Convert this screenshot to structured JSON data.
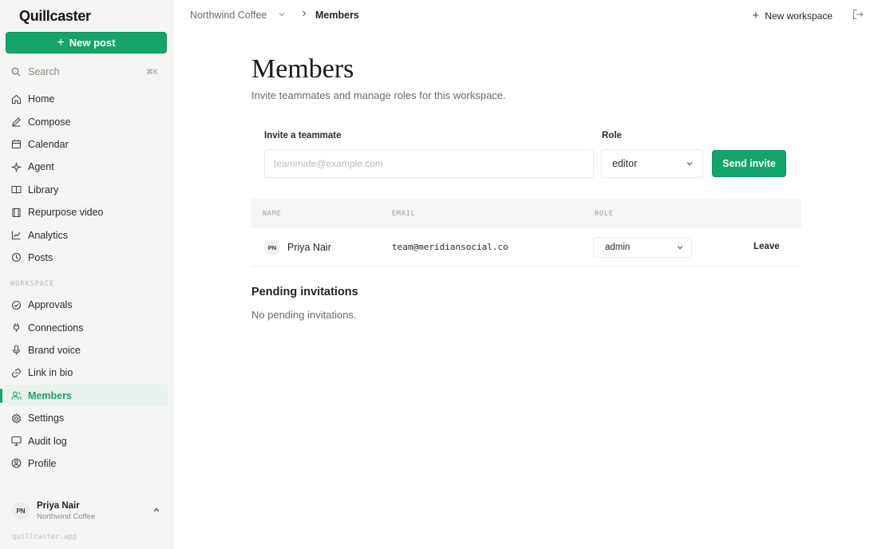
{
  "app": {
    "brand": "Quillcaster",
    "domain_footer": "quillcaster.app"
  },
  "sidebar": {
    "new_post_label": "New post",
    "search": {
      "placeholder": "Search",
      "shortcut": "⌘K"
    },
    "items": [
      {
        "label": "Home",
        "icon": "home-icon"
      },
      {
        "label": "Compose",
        "icon": "pencil-icon"
      },
      {
        "label": "Calendar",
        "icon": "calendar-icon"
      },
      {
        "label": "Agent",
        "icon": "sparkle-icon"
      },
      {
        "label": "Library",
        "icon": "book-icon"
      },
      {
        "label": "Repurpose video",
        "icon": "film-icon"
      },
      {
        "label": "Analytics",
        "icon": "chart-icon"
      },
      {
        "label": "Posts",
        "icon": "clock-icon"
      }
    ],
    "section_label": "WORKSPACE",
    "workspace_items": [
      {
        "label": "Approvals",
        "icon": "check-circle-icon"
      },
      {
        "label": "Connections",
        "icon": "plug-icon"
      },
      {
        "label": "Brand voice",
        "icon": "mic-icon"
      },
      {
        "label": "Link in bio",
        "icon": "link-icon"
      },
      {
        "label": "Members",
        "icon": "users-icon",
        "active": true
      },
      {
        "label": "Settings",
        "icon": "gear-icon"
      },
      {
        "label": "Audit log",
        "icon": "monitor-icon"
      },
      {
        "label": "Profile",
        "icon": "user-circle-icon"
      }
    ],
    "user": {
      "initials": "PN",
      "name": "Priya Nair",
      "org": "Northwind Coffee"
    }
  },
  "topbar": {
    "workspace": "Northwind Coffee",
    "page": "Members",
    "new_workspace_label": "New workspace"
  },
  "main": {
    "title": "Members",
    "subtitle": "Invite teammates and manage roles for this workspace.",
    "invite": {
      "label": "Invite a teammate",
      "placeholder": "teammate@example.com",
      "role_label": "Role",
      "role_value": "editor",
      "send_label": "Send invite"
    },
    "table": {
      "headers": {
        "name": "NAME",
        "email": "EMAIL",
        "role": "ROLE"
      },
      "rows": [
        {
          "initials": "PN",
          "name": "Priya Nair",
          "email": "team@meridiansocial.co",
          "role": "admin",
          "action": "Leave"
        }
      ]
    },
    "pending": {
      "title": "Pending invitations",
      "empty": "No pending invitations."
    }
  },
  "colors": {
    "accent": "#15a46b",
    "sidebar_bg": "#f5f5f4"
  }
}
